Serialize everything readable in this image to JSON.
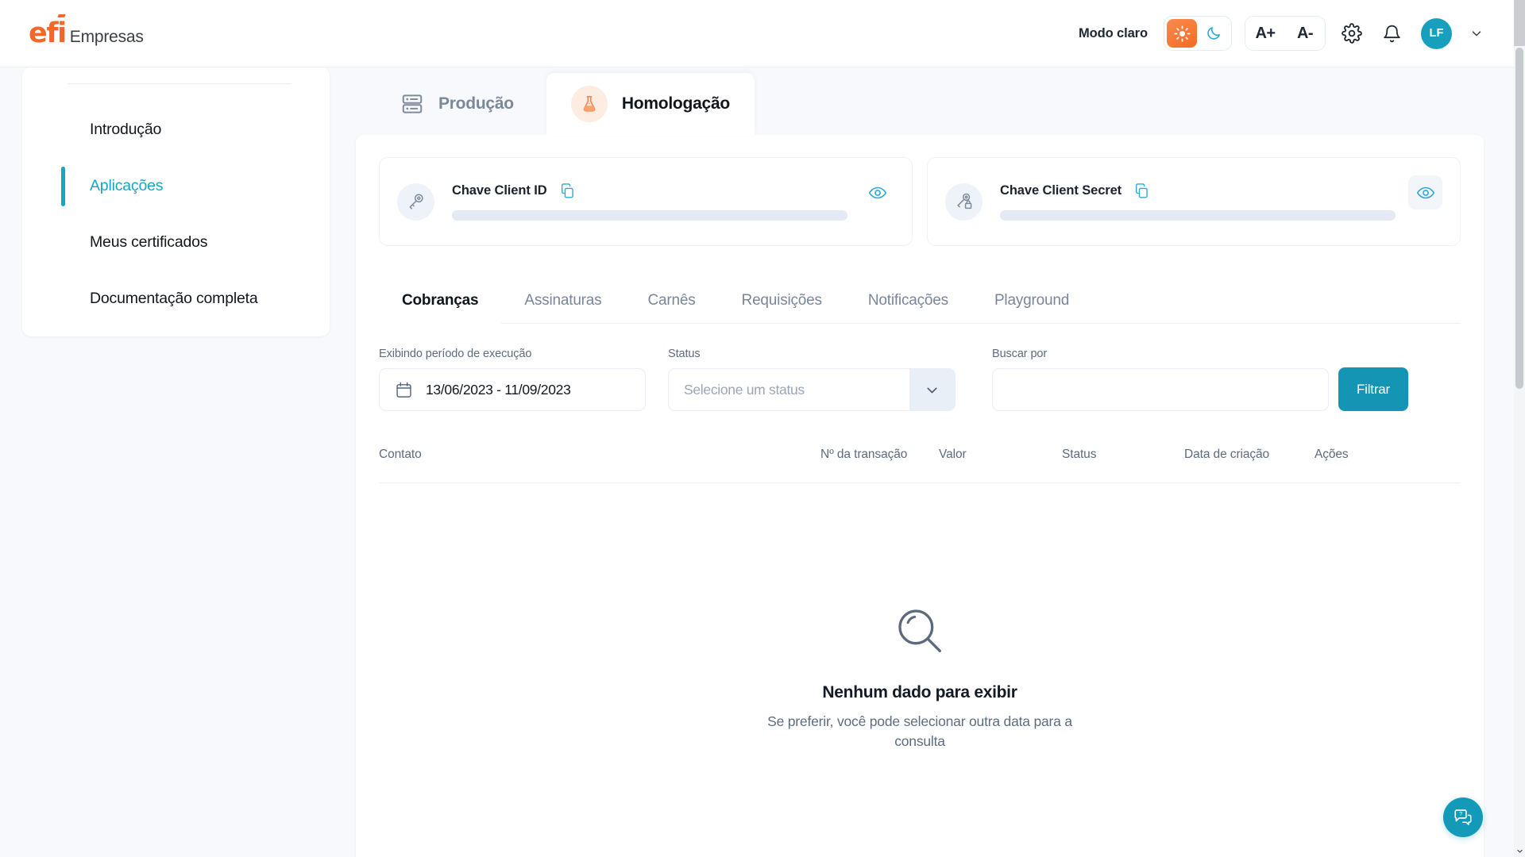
{
  "brand": {
    "mark": "efi",
    "sub": "Empresas"
  },
  "header": {
    "mode_label": "Modo claro",
    "light_mode_icon": "sun-icon",
    "dark_mode_icon": "moon-icon",
    "increase_text_label": "A+",
    "decrease_text_label": "A-",
    "settings_icon": "gear-icon",
    "notifications_icon": "bell-icon",
    "avatar_initials": "LF",
    "avatar_caret_icon": "chevron-down-icon",
    "accent_orange": "#f2682a",
    "accent_teal": "#16a0be"
  },
  "sidebar": {
    "items": [
      {
        "label": "Introdução",
        "active": false
      },
      {
        "label": "Aplicações",
        "active": true
      },
      {
        "label": "Meus certificados",
        "active": false
      },
      {
        "label": "Documentação completa",
        "active": false
      }
    ],
    "active_color": "#18a5c6"
  },
  "env_tabs": [
    {
      "label": "Produção",
      "icon": "server-icon",
      "active": false
    },
    {
      "label": "Homologação",
      "icon": "flask-icon",
      "active": true
    }
  ],
  "credentials": [
    {
      "label": "Chave Client ID",
      "icon": "key-icon",
      "copy_icon": "copy-icon",
      "reveal_icon": "eye-icon",
      "value_masked": true,
      "reveal_hovered": false
    },
    {
      "label": "Chave Client Secret",
      "icon": "key-lock-icon",
      "copy_icon": "copy-icon",
      "reveal_icon": "eye-icon",
      "value_masked": true,
      "reveal_hovered": true
    }
  ],
  "inner_tabs": [
    {
      "label": "Cobranças",
      "active": true
    },
    {
      "label": "Assinaturas",
      "active": false
    },
    {
      "label": "Carnês",
      "active": false
    },
    {
      "label": "Requisições",
      "active": false
    },
    {
      "label": "Notificações",
      "active": false
    },
    {
      "label": "Playground",
      "active": false
    }
  ],
  "filters": {
    "date": {
      "label": "Exibindo período de execução",
      "value": "13/06/2023 - 11/09/2023",
      "icon": "calendar-icon"
    },
    "status": {
      "label": "Status",
      "placeholder": "Selecione um status",
      "value": "",
      "caret_icon": "chevron-down-icon"
    },
    "search": {
      "label": "Buscar por",
      "placeholder": "",
      "value": ""
    },
    "submit_label": "Filtrar",
    "submit_color": "#1495b4"
  },
  "table": {
    "columns": [
      "Contato",
      "Nº da transação",
      "Valor",
      "Status",
      "Data de criação",
      "Ações"
    ],
    "rows": []
  },
  "empty_state": {
    "icon": "magnifier-icon",
    "title": "Nenhum dado para exibir",
    "subtitle": "Se preferir, você pode selecionar outra data para a consulta"
  },
  "chat": {
    "icon": "chat-help-icon",
    "color": "#139ab9"
  }
}
